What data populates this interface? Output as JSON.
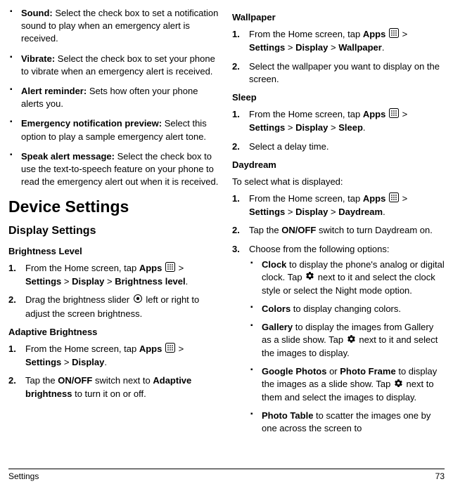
{
  "left": {
    "bullets": [
      {
        "label": "Sound:",
        "text": " Select the check box to set a notification sound to play when an emergency alert is received."
      },
      {
        "label": "Vibrate:",
        "text": " Select the check box to set your phone to vibrate when an emergency alert is received."
      },
      {
        "label": "Alert reminder:",
        "text": " Sets how often your phone alerts you."
      },
      {
        "label": "Emergency notification preview:",
        "text": " Select this option to play a sample emergency alert tone."
      },
      {
        "label": "Speak alert message:",
        "text": " Select the check box to use the text-to-speech feature on your phone to read the emergency alert out when it is received."
      }
    ],
    "h1": "Device Settings",
    "h2": "Display Settings",
    "brightness": {
      "heading": "Brightness Level",
      "step1a": "From the Home screen, tap ",
      "apps": "Apps",
      "step1b": " > ",
      "settings": "Settings",
      "display": "Display",
      "brightnessLevel": "Brightness level",
      "gt": " > ",
      "step2a": "Drag the brightness slider ",
      "step2b": " left or right to adjust the screen brightness."
    },
    "adaptive": {
      "heading": "Adaptive Brightness",
      "step1a": "From the Home screen, tap ",
      "apps": "Apps",
      "gt": " > ",
      "settings": "Settings",
      "display": "Display",
      "step2a": "Tap the ",
      "onoff": "ON/OFF",
      "step2b": " switch next to ",
      "ab": "Adaptive brightness",
      "step2c": " to turn it on or off."
    }
  },
  "right": {
    "wallpaper": {
      "heading": "Wallpaper",
      "step1a": "From the Home screen, tap ",
      "apps": "Apps",
      "gt": " > ",
      "settings": "Settings",
      "display": "Display",
      "wallpaper": "Wallpaper",
      "step2": "Select the wallpaper you want to display on the screen."
    },
    "sleep": {
      "heading": "Sleep",
      "step1a": "From the Home screen, tap ",
      "apps": "Apps",
      "gt": " > ",
      "settings": "Settings",
      "display": "Display",
      "sleep": "Sleep",
      "step2": "Select a delay time."
    },
    "daydream": {
      "heading": "Daydream",
      "intro": "To select what is displayed:",
      "step1a": "From the Home screen, tap ",
      "apps": "Apps",
      "gt": " > ",
      "settings": "Settings",
      "display": "Display",
      "daydream": "Daydream",
      "step2a": "Tap the ",
      "onoff": "ON/OFF",
      "step2b": " switch to turn Daydream on.",
      "step3": "Choose from the following options:",
      "opts": {
        "clock": {
          "b": "Clock",
          "t1": " to display the phone's analog or digital clock. Tap ",
          "t2": " next to it and select the clock style or select the Night mode option."
        },
        "colors": {
          "b": "Colors",
          "t": " to display changing colors."
        },
        "gallery": {
          "b": "Gallery",
          "t1": " to display the images from Gallery as a slide show. Tap ",
          "t2": " next to it and select the images to display."
        },
        "gphotos": {
          "b1": "Google Photos",
          "or": " or ",
          "b2": "Photo Frame",
          "t1": " to display the images as a slide show. Tap ",
          "t2": " next to them and select the images to display."
        },
        "ptable": {
          "b": "Photo Table",
          "t": " to scatter the images one by one across the screen to"
        }
      }
    }
  },
  "footer": {
    "left": "Settings",
    "right": "73"
  }
}
